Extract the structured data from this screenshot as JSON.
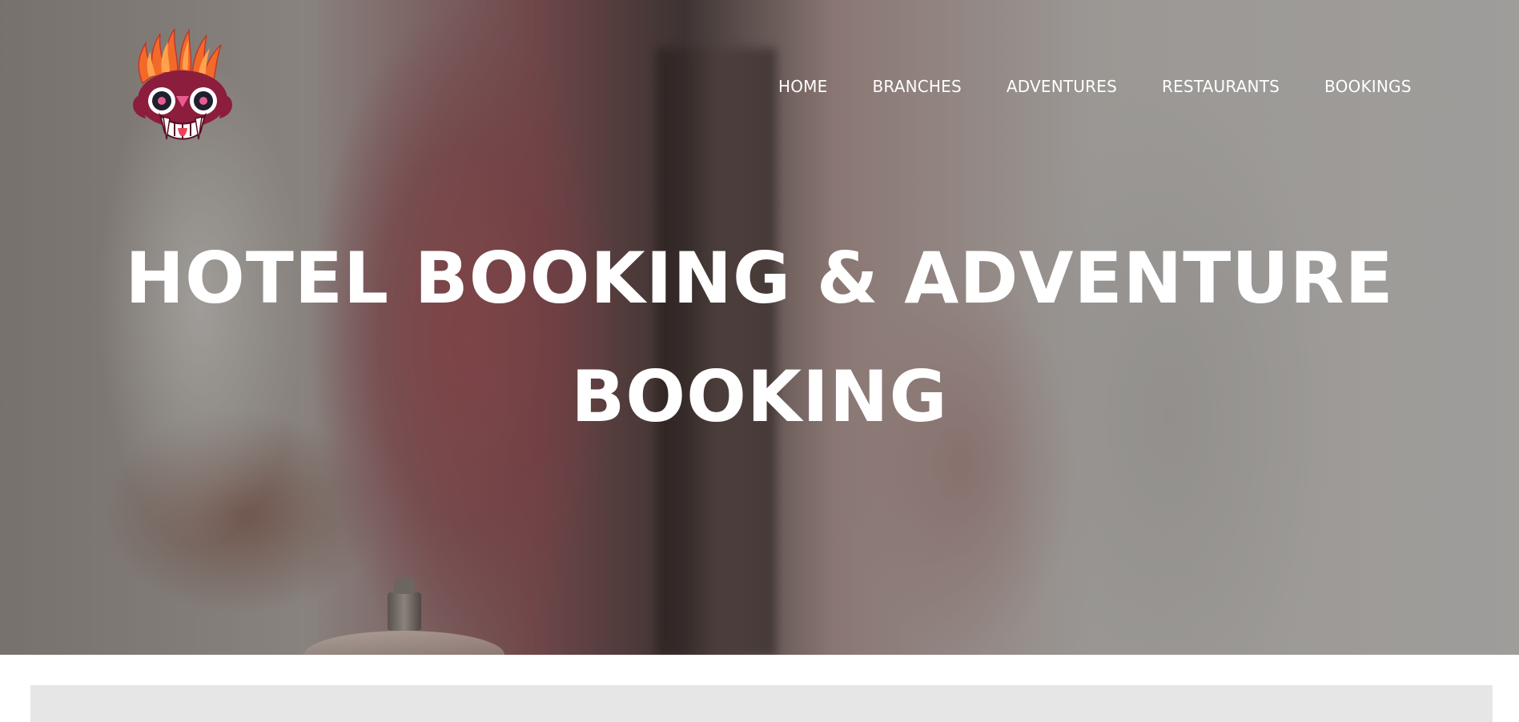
{
  "logo": {
    "icon": "demon-mask-icon"
  },
  "nav": {
    "items": [
      {
        "label": "HOME"
      },
      {
        "label": "BRANCHES"
      },
      {
        "label": "ADVENTURES"
      },
      {
        "label": "RESTAURANTS"
      },
      {
        "label": "BOOKINGS"
      }
    ]
  },
  "hero": {
    "title_line1": "HOTEL BOOKING & ADVENTURE",
    "title_line2": "BOOKING"
  },
  "colors": {
    "text": "#ffffff",
    "panel": "#e6e6e6",
    "logo_maroon": "#8c1d3c",
    "logo_orange": "#f26a2a"
  }
}
